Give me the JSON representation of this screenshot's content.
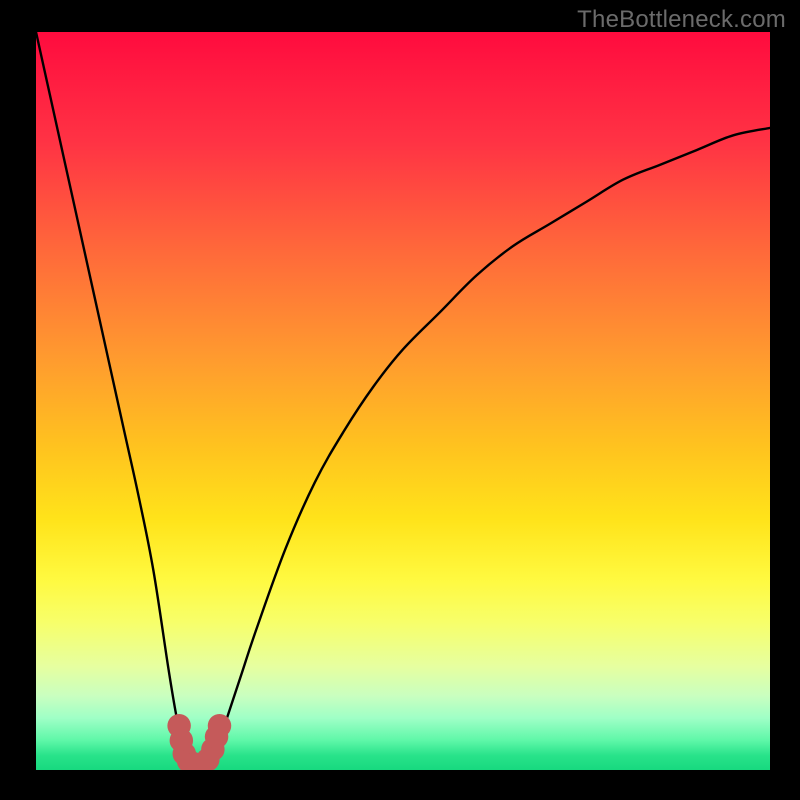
{
  "watermark": {
    "text": "TheBottleneck.com"
  },
  "chart_data": {
    "type": "line",
    "title": "",
    "xlabel": "",
    "ylabel": "",
    "xlim": [
      0,
      100
    ],
    "ylim": [
      0,
      100
    ],
    "grid": false,
    "legend": false,
    "series": [
      {
        "name": "curve",
        "x": [
          0,
          2,
          4,
          6,
          8,
          10,
          12,
          14,
          16,
          18,
          19,
          20,
          21,
          22,
          23,
          24,
          25,
          26,
          28,
          30,
          34,
          38,
          42,
          46,
          50,
          55,
          60,
          65,
          70,
          75,
          80,
          85,
          90,
          95,
          100
        ],
        "y": [
          100,
          91,
          82,
          73,
          64,
          55,
          46,
          37,
          27,
          14,
          8,
          3,
          1,
          0,
          1,
          2,
          4,
          7,
          13,
          19,
          30,
          39,
          46,
          52,
          57,
          62,
          67,
          71,
          74,
          77,
          80,
          82,
          84,
          86,
          87
        ]
      }
    ],
    "markers": {
      "name": "valley-highlight",
      "color": "#c55a5a",
      "radius_pct": 1.6,
      "points": [
        {
          "x": 19.5,
          "y": 6
        },
        {
          "x": 19.8,
          "y": 4
        },
        {
          "x": 20.2,
          "y": 2.2
        },
        {
          "x": 20.8,
          "y": 1.2
        },
        {
          "x": 21.6,
          "y": 0.8
        },
        {
          "x": 22.6,
          "y": 0.8
        },
        {
          "x": 23.4,
          "y": 1.4
        },
        {
          "x": 24.1,
          "y": 2.8
        },
        {
          "x": 24.6,
          "y": 4.5
        },
        {
          "x": 25.0,
          "y": 6
        }
      ]
    }
  }
}
